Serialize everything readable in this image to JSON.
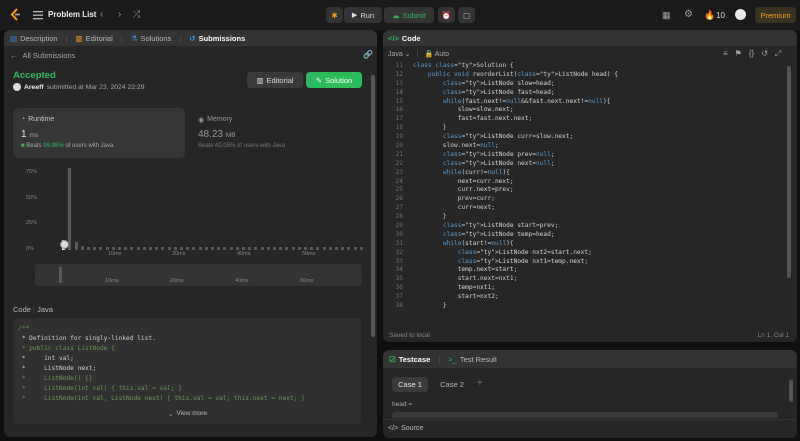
{
  "topbar": {
    "title": "Problem List",
    "run": "Run",
    "submit": "Submit",
    "streak": "10",
    "premium": "Premium"
  },
  "left": {
    "tabs": [
      "Description",
      "Editorial",
      "Solutions",
      "Submissions"
    ],
    "back": "All Submissions",
    "status": "Accepted",
    "user": "Areeff",
    "submitted": " submitted at Mar 23, 2024 22:29",
    "editorial_btn": "Editorial",
    "solution_btn": "Solution",
    "runtime": {
      "label": "Runtime",
      "value": "1",
      "unit": "ms",
      "beats_prefix": "Beats ",
      "beats": "99.98%",
      "beats_suffix": " of users with Java"
    },
    "memory": {
      "label": "Memory",
      "value": "48.23",
      "unit": "MB",
      "beats_prefix": "Beats ",
      "beats": "42.05%",
      "beats_suffix": " of users with Java"
    },
    "chart": {
      "y_ticks": [
        "75%",
        "50%",
        "25%",
        "0%"
      ],
      "x_ticks": [
        "10ms",
        "20ms",
        "40ms",
        "50ms"
      ],
      "mini_ticks": [
        "10ms",
        "20ms",
        "40ms",
        "60ms"
      ]
    },
    "code_label": "Code",
    "code_lang": "Java",
    "code_lines": [
      "/**",
      " * Definition for singly-linked list.",
      " * public class ListNode {",
      " *     int val;",
      " *     ListNode next;",
      " *     ListNode() {}",
      " *     ListNode(int val) { this.val = val; }",
      " *     ListNode(int val, ListNode next) { this.val = val; this.next = next; }"
    ],
    "view_more": "View more"
  },
  "editor": {
    "title": "Code",
    "lang": "Java",
    "mode": "Auto",
    "saved": "Saved to local",
    "cursor": "Ln 1, Col 1",
    "start_line": 11,
    "lines": [
      "class Solution {",
      "    public void reorderList(ListNode head) {",
      "        ListNode slow=head;",
      "        ListNode fast=head;",
      "        while(fast.next!=null&&fast.next.next!=null){",
      "            slow=slow.next;",
      "            fast=fast.next.next;",
      "        }",
      "        ListNode curr=slow.next;",
      "        slow.next=null;",
      "        ListNode prev=null;",
      "        ListNode next=null;",
      "        while(curr!=null){",
      "            next=curr.next;",
      "            curr.next=prev;",
      "            prev=curr;",
      "            curr=next;",
      "        }",
      "        ListNode start=prev;",
      "        ListNode temp=head;",
      "        while(start!=null){",
      "            ListNode nxt2=start.next;",
      "            ListNode nxt1=temp.next;",
      "            temp.next=start;",
      "            start.next=nxt1;",
      "            temp=nxt1;",
      "            start=nxt2;",
      "        }"
    ]
  },
  "testcase": {
    "tab1": "Testcase",
    "tab2": "Test Result",
    "case1": "Case 1",
    "case2": "Case 2",
    "field": "head =",
    "source": "Source"
  }
}
